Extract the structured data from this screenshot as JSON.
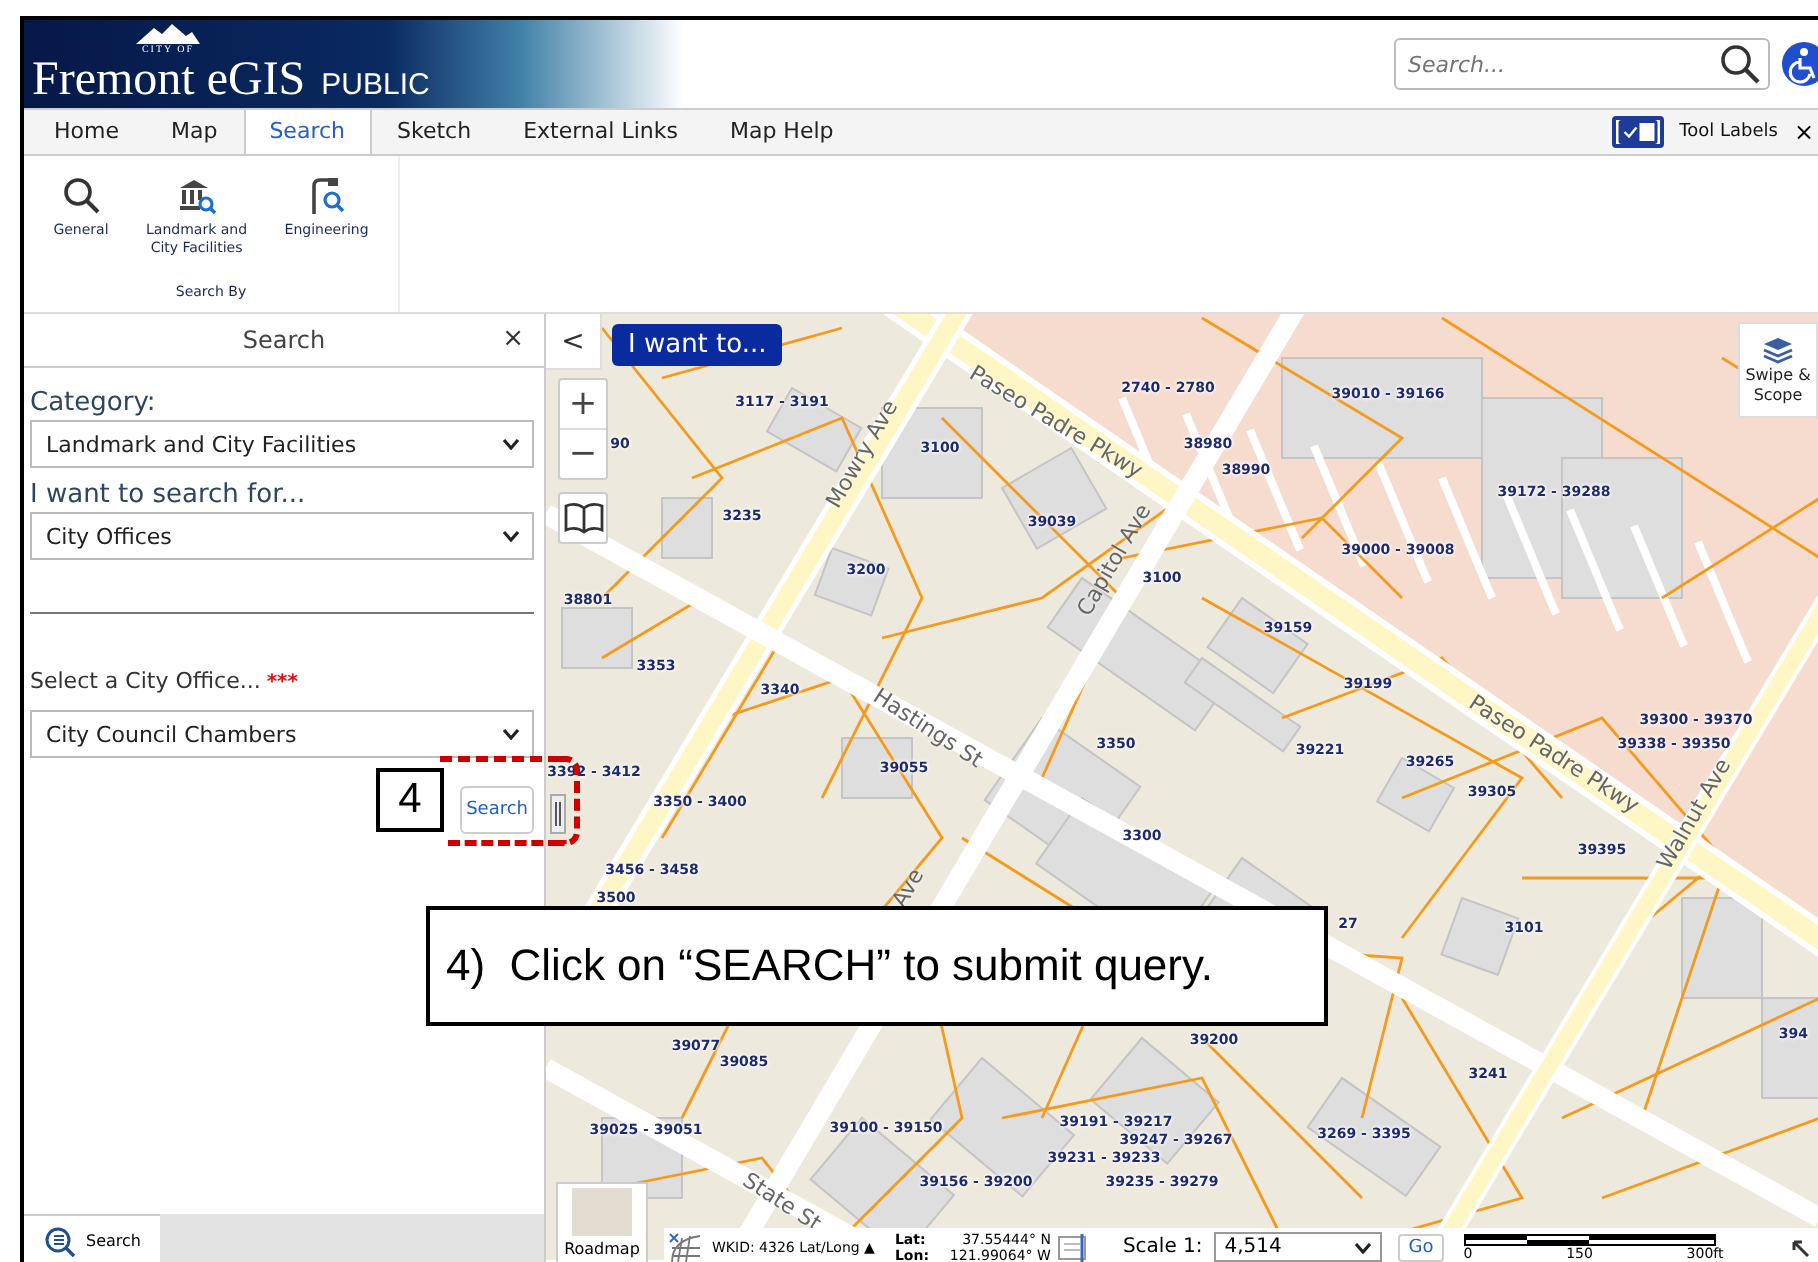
{
  "header": {
    "logo_small": "CITY OF",
    "logo_title": "Fremont eGIS",
    "logo_sub": "PUBLIC",
    "search": {
      "placeholder": "Search..."
    }
  },
  "tabs": [
    {
      "label": "Home",
      "selected": false
    },
    {
      "label": "Map",
      "selected": false
    },
    {
      "label": "Search",
      "selected": true
    },
    {
      "label": "Sketch",
      "selected": false
    },
    {
      "label": "External Links",
      "selected": false
    },
    {
      "label": "Map Help",
      "selected": false
    }
  ],
  "tool_labels": {
    "label": "Tool Labels",
    "checked": true,
    "close": "×"
  },
  "ribbon": {
    "group": "Search By",
    "items": [
      {
        "label": "General",
        "kind": "search"
      },
      {
        "label": "Landmark and City Facilities",
        "kind": "landmark"
      },
      {
        "label": "Engineering",
        "kind": "engineering"
      }
    ]
  },
  "panel": {
    "title": "Search",
    "close": "×",
    "fields": [
      {
        "label": "Category:",
        "value": "Landmark and City Facilities"
      },
      {
        "label": "I want to search for...",
        "value": "City Offices"
      },
      {
        "label": "Select a City Office...",
        "required": "***",
        "value": "City Council Chambers"
      }
    ],
    "button": "Search",
    "bottom_tab": "Search"
  },
  "map": {
    "collapse": "<",
    "i_want_to": "I want to...",
    "zoom_in": "+",
    "zoom_out": "−",
    "swipe": "Swipe & Scope",
    "parcels": [
      "3117 - 3191",
      "90",
      "3100",
      "3235",
      "39039",
      "3200",
      "38801",
      "3353",
      "3340",
      "3392 - 3412",
      "39055",
      "3350 - 3400",
      "3456 - 3458",
      "3500",
      "2740 - 2780",
      "39010 - 39166",
      "38980",
      "38990",
      "39172 - 39288",
      "39000 - 39008",
      "3100",
      "39159",
      "39199",
      "39221",
      "39265",
      "39305",
      "3350",
      "3300",
      "39300 - 39370",
      "39338 - 39350",
      "39395",
      "3101",
      "27",
      "39200",
      "3241",
      "39077",
      "39085",
      "39025 - 39051",
      "39100 - 39150",
      "39191 - 39217",
      "39247 - 39267",
      "39231 - 39233",
      "39156 - 39200",
      "39235 - 39279",
      "3269 - 3395",
      "394"
    ],
    "streets": [
      "Mowry Ave",
      "Paseo Padre Pkwy",
      "Capitol Ave",
      "Hastings St",
      "Paseo Padre Pkwy",
      "Walnut Ave",
      "Ave",
      "State St"
    ]
  },
  "basemap": {
    "label": "Roadmap"
  },
  "coords": {
    "wkid": "WKID: 4326 Lat/Long ▲",
    "lat_label": "Lat:",
    "lat": "37.55444° N",
    "lon_label": "Lon:",
    "lon": "121.99064° W"
  },
  "scale": {
    "label": "Scale 1:",
    "value": "4,514",
    "go": "Go",
    "ticks": [
      "0",
      "150",
      "300ft"
    ]
  },
  "annotation": {
    "step": "4",
    "callout": "4)  Click on “SEARCH” to submit query."
  }
}
